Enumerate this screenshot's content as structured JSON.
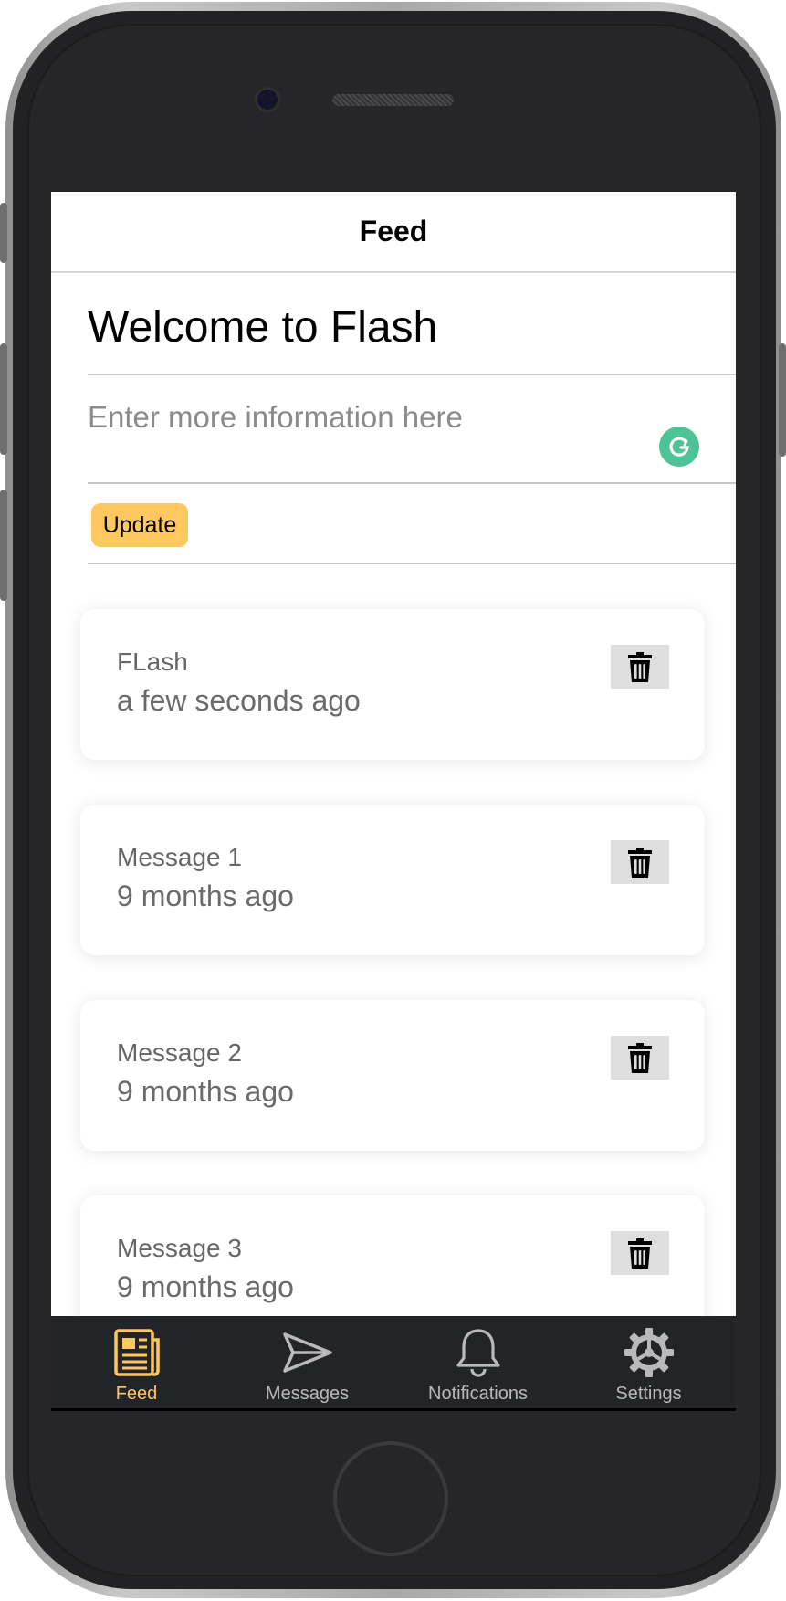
{
  "header": {
    "title": "Feed"
  },
  "welcome": {
    "title": "Welcome to Flash"
  },
  "info_input": {
    "placeholder": "Enter more information here",
    "value": ""
  },
  "update_button": {
    "label": "Update"
  },
  "messages": [
    {
      "title": "FLash",
      "time": "a few seconds ago"
    },
    {
      "title": "Message 1",
      "time": "9 months ago"
    },
    {
      "title": "Message 2",
      "time": "9 months ago"
    },
    {
      "title": "Message 3",
      "time": "9 months ago"
    }
  ],
  "tabs": [
    {
      "label": "Feed",
      "icon": "newspaper-icon",
      "active": true
    },
    {
      "label": "Messages",
      "icon": "send-icon",
      "active": false
    },
    {
      "label": "Notifications",
      "icon": "bell-icon",
      "active": false
    },
    {
      "label": "Settings",
      "icon": "gear-icon",
      "active": false
    }
  ],
  "colors": {
    "accent": "#ffc75f",
    "tabbar_bg": "#232427",
    "tab_inactive": "#b9b9bb",
    "grammarly": "#4ec398"
  }
}
